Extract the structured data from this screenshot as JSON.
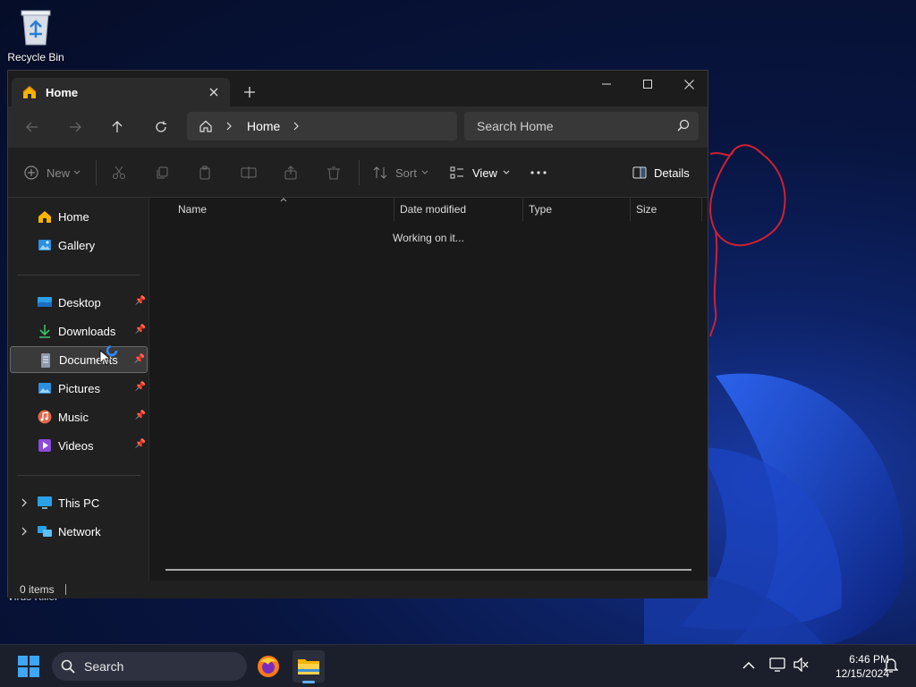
{
  "desktop": {
    "recycle_bin_label": "Recycle Bin",
    "second_icon_label": "Virus Killer"
  },
  "window": {
    "tab_title": "Home",
    "breadcrumb": [
      "Home"
    ],
    "search_placeholder": "Search Home",
    "toolbar": {
      "new_label": "New",
      "sort_label": "Sort",
      "view_label": "View",
      "details_label": "Details"
    },
    "sidebar": {
      "top_items": [
        {
          "label": "Home"
        },
        {
          "label": "Gallery"
        }
      ],
      "pinned_items": [
        {
          "label": "Desktop"
        },
        {
          "label": "Downloads"
        },
        {
          "label": "Documents"
        },
        {
          "label": "Pictures"
        },
        {
          "label": "Music"
        },
        {
          "label": "Videos"
        }
      ],
      "tree_items": [
        {
          "label": "This PC"
        },
        {
          "label": "Network"
        }
      ]
    },
    "columns": [
      "Name",
      "Date modified",
      "Type",
      "Size"
    ],
    "status_message": "Working on it...",
    "status_bar": "0 items"
  },
  "taskbar": {
    "search_label": "Search",
    "time": "6:46 PM",
    "date": "12/15/2024"
  }
}
